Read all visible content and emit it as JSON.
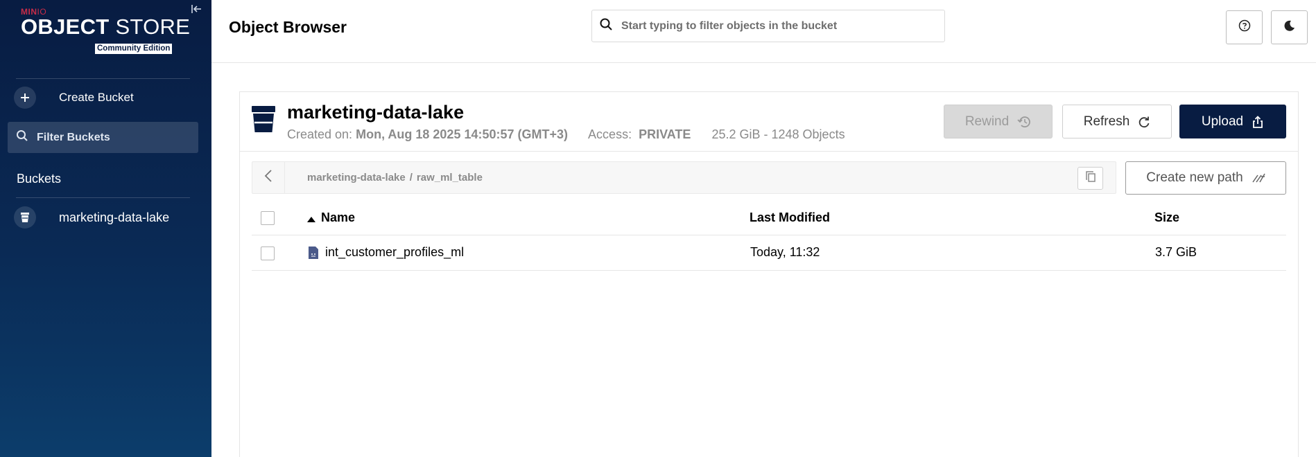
{
  "sidebar": {
    "brand": "MIN",
    "brand_io": "IO",
    "product_bold": "OBJECT",
    "product_light": " STORE",
    "edition": "Community Edition",
    "create_bucket_label": "Create Bucket",
    "filter_placeholder": "Filter Buckets",
    "buckets_heading": "Buckets",
    "buckets": [
      {
        "name": "marketing-data-lake"
      }
    ]
  },
  "header": {
    "title": "Object Browser",
    "search_placeholder": "Start typing to filter objects in the bucket"
  },
  "bucket": {
    "name": "marketing-data-lake",
    "created_label": "Created on:",
    "created_value": "Mon, Aug 18 2025 14:50:57 (GMT+3)",
    "access_label": "Access:",
    "access_value": "PRIVATE",
    "usage": "25.2 GiB - 1248 Objects"
  },
  "toolbar": {
    "rewind_label": "Rewind",
    "refresh_label": "Refresh",
    "upload_label": "Upload",
    "create_path_label": "Create new path"
  },
  "breadcrumb": [
    "marketing-data-lake",
    "raw_ml_table"
  ],
  "breadcrumb_separator": "/",
  "table": {
    "columns": [
      "Name",
      "Last Modified",
      "Size"
    ],
    "rows": [
      {
        "name": "int_customer_profiles_ml",
        "modified": "Today, 11:32",
        "size": "3.7 GiB"
      }
    ]
  },
  "icons": [
    "collapse-sidebar-icon",
    "plus-icon",
    "search-icon",
    "bucket-icon",
    "help-icon",
    "dark-mode-icon",
    "rewind-icon",
    "refresh-icon",
    "upload-icon",
    "back-chevron-icon",
    "copy-icon",
    "new-path-icon",
    "sort-asc-icon",
    "file-icon"
  ],
  "colors": {
    "sidebar": "#081c42",
    "brand": "#c72c48",
    "primary_button": "#081c42"
  }
}
